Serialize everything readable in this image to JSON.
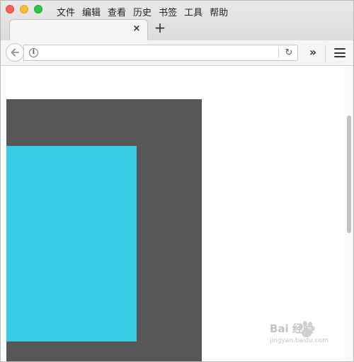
{
  "window": {
    "menu": [
      "文件",
      "编辑",
      "查看",
      "历史",
      "书签",
      "工具",
      "帮助"
    ]
  },
  "tab": {
    "close_glyph": "×"
  },
  "new_tab_glyph": "+",
  "toolbar": {
    "url_value": "",
    "info_glyph": "i",
    "reload_glyph": "↻",
    "overflow_glyph": "»"
  },
  "content": {
    "dark_box_color": "#575757",
    "cyan_box_color": "#37cbe5"
  },
  "watermark": {
    "main": "Bai 经验",
    "sub": "jingyan.baidu.com"
  },
  "colors": {
    "close_light": "#fc5f57",
    "minimize_light": "#fdbc2e",
    "zoom_light": "#28c840"
  }
}
